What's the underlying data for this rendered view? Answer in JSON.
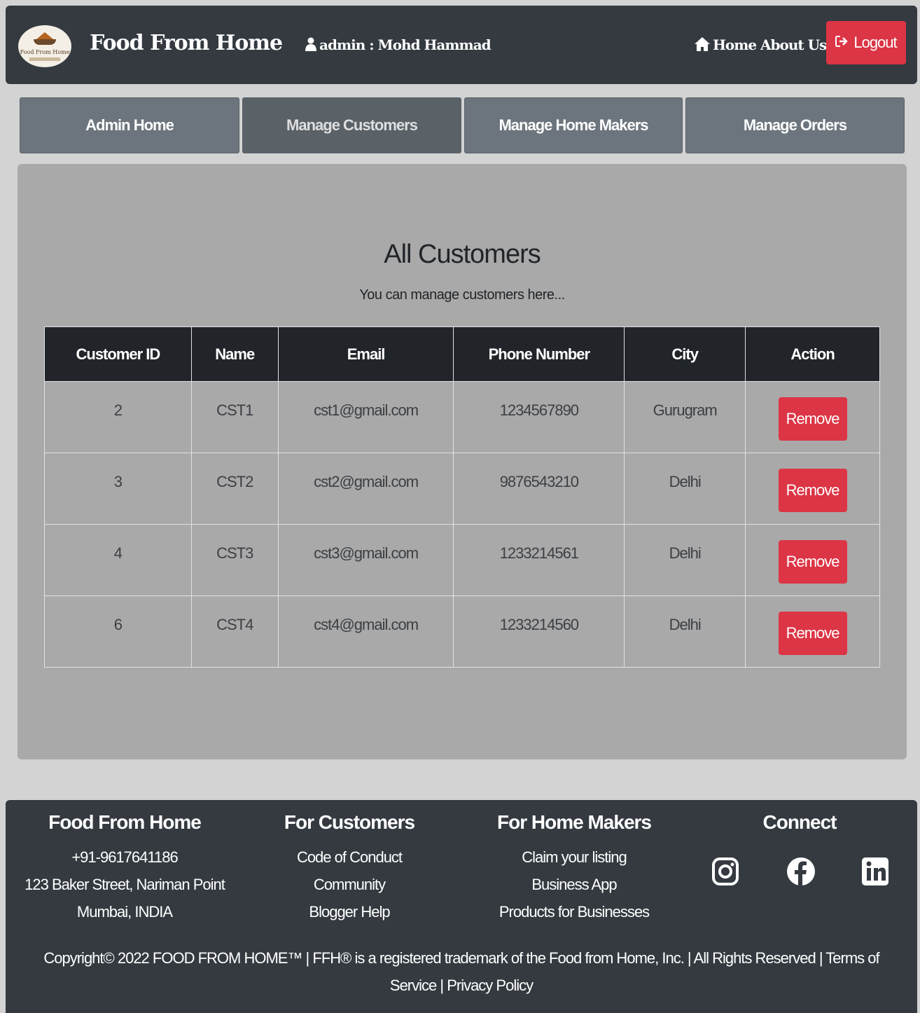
{
  "navbar": {
    "brand": "Food From Home",
    "logo_text": "Food From Home",
    "admin_label": "admin : Mohd Hammad",
    "home": "Home",
    "about": "About Us",
    "logout": "Logout"
  },
  "tabs": [
    {
      "label": "Admin Home"
    },
    {
      "label": "Manage Customers"
    },
    {
      "label": "Manage Home Makers"
    },
    {
      "label": "Manage Orders"
    }
  ],
  "main": {
    "title": "All Customers",
    "subtitle": "You can manage customers here...",
    "columns": [
      "Customer ID",
      "Name",
      "Email",
      "Phone Number",
      "City",
      "Action"
    ],
    "rows": [
      {
        "id": "2",
        "name": "CST1",
        "email": "cst1@gmail.com",
        "phone": "1234567890",
        "city": "Gurugram",
        "action": "Remove"
      },
      {
        "id": "3",
        "name": "CST2",
        "email": "cst2@gmail.com",
        "phone": "9876543210",
        "city": "Delhi",
        "action": "Remove"
      },
      {
        "id": "4",
        "name": "CST3",
        "email": "cst3@gmail.com",
        "phone": "1233214561",
        "city": "Delhi",
        "action": "Remove"
      },
      {
        "id": "6",
        "name": "CST4",
        "email": "cst4@gmail.com",
        "phone": "1233214560",
        "city": "Delhi",
        "action": "Remove"
      }
    ]
  },
  "footer": {
    "col1": {
      "heading": "Food From Home",
      "lines": [
        "+91-9617641186",
        "123 Baker Street, Nariman Point",
        "Mumbai, INDIA"
      ]
    },
    "col2": {
      "heading": "For Customers",
      "links": [
        "Code of Conduct",
        "Community",
        "Blogger Help"
      ]
    },
    "col3": {
      "heading": "For Home Makers",
      "links": [
        "Claim your listing",
        "Business App",
        "Products for Businesses"
      ]
    },
    "col4": {
      "heading": "Connect",
      "icons": [
        "instagram-icon",
        "facebook-icon",
        "linkedin-icon"
      ]
    },
    "copyright": "Copyright© 2022 FOOD FROM HOME™ | FFH® is a registered trademark of the Food from Home, Inc. | All Rights Reserved | Terms of Service | Privacy Policy"
  },
  "colors": {
    "navbar": "#343a40",
    "danger": "#dc3545",
    "tab": "#6c757d",
    "panel": "#a9a9a9",
    "table_head": "#212529"
  }
}
